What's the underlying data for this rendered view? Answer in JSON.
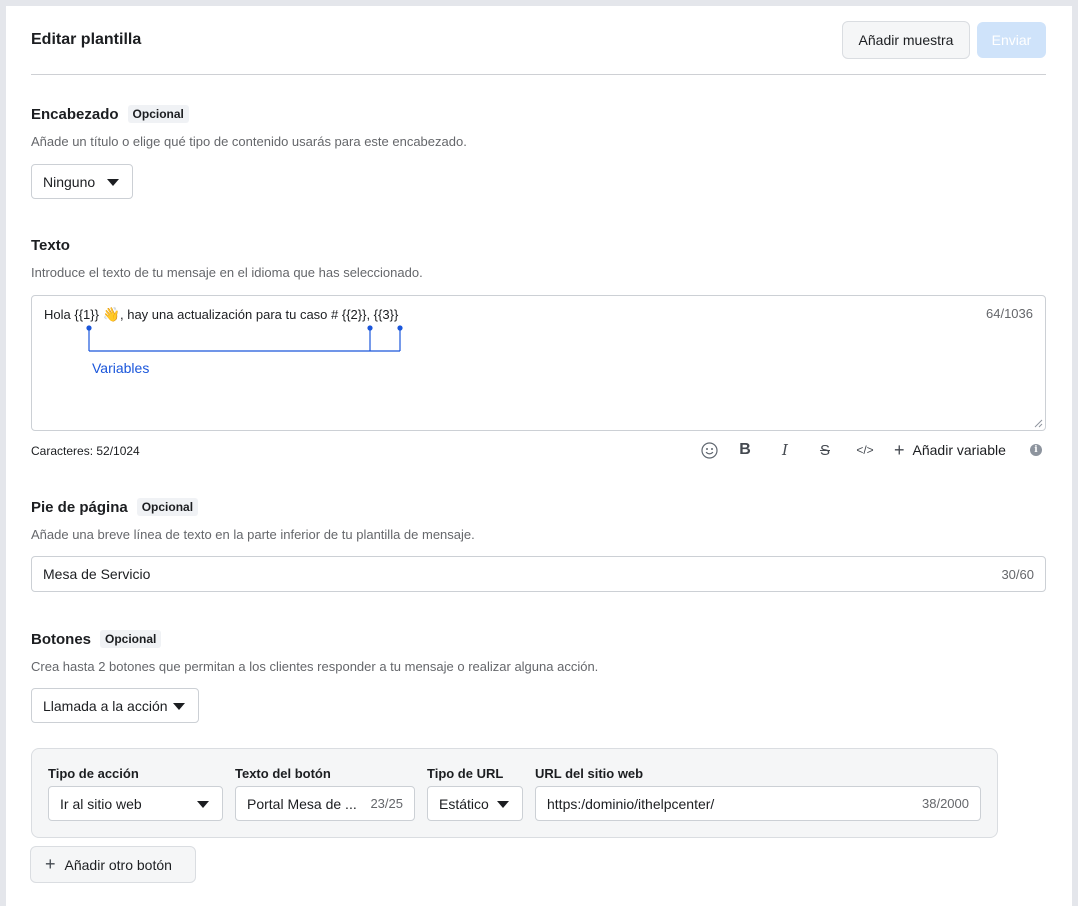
{
  "header": {
    "title": "Editar plantilla",
    "add_sample_label": "Añadir muestra",
    "send_label": "Enviar"
  },
  "sections": {
    "header_section": {
      "title": "Encabezado",
      "badge": "Opcional",
      "description": "Añade un título o elige qué tipo de contenido usarás para este encabezado.",
      "select_value": "Ninguno"
    },
    "body_section": {
      "title": "Texto",
      "description": "Introduce el texto de tu mensaje en el idioma que has seleccionado.",
      "message_before_emoji": "Hola {{1}} ",
      "emoji": "👋",
      "message_after_emoji": ", hay una actualización para tu caso # {{2}}, {{3}}",
      "counter": "64/1036",
      "annotation_label": "Variables",
      "chars_label": "Caracteres: 52/1024",
      "toolbar": {
        "emoji_icon": "emoji-icon",
        "bold_glyph": "B",
        "italic_glyph": "I",
        "strike_glyph": "S",
        "code_glyph": "</>",
        "add_variable_label": "Añadir variable",
        "info_glyph": "i"
      }
    },
    "footer_section": {
      "title": "Pie de página",
      "badge": "Opcional",
      "description": "Añade una breve línea de texto en la parte inferior de tu plantilla de mensaje.",
      "value": "Mesa de Servicio",
      "counter": "30/60"
    },
    "buttons_section": {
      "title": "Botones",
      "badge": "Opcional",
      "description": "Crea hasta 2 botones que permitan a los clientes responder a tu mensaje o realizar alguna acción.",
      "select_value": "Llamada a la acción",
      "fields": {
        "action_type_label": "Tipo de acción",
        "action_type_value": "Ir al sitio web",
        "button_text_label": "Texto del botón",
        "button_text_value": "Portal Mesa de ...",
        "button_text_counter": "23/25",
        "url_type_label": "Tipo de URL",
        "url_type_value": "Estático",
        "url_label": "URL del sitio web",
        "url_value": "https:/dominio/ithelpcenter/",
        "url_counter": "38/2000"
      },
      "add_button_label": "Añadir otro botón"
    }
  },
  "colors": {
    "accent": "#1877f2",
    "annotation": "#1a56db",
    "send_disabled": "#cfe3fa"
  }
}
